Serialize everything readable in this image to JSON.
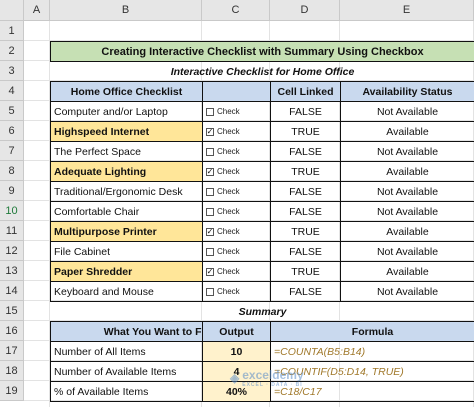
{
  "columns": [
    "A",
    "B",
    "C",
    "D",
    "E"
  ],
  "rows": [
    "1",
    "2",
    "3",
    "4",
    "5",
    "6",
    "7",
    "8",
    "9",
    "10",
    "11",
    "12",
    "13",
    "14",
    "15",
    "16",
    "17",
    "18",
    "19"
  ],
  "title": "Creating Interactive Checklist with Summary Using Checkbox",
  "checklist_caption": "Interactive Checklist for Home Office",
  "checklist_headers": {
    "item": "Home Office Checklist",
    "check": "",
    "linked": "Cell Linked",
    "status": "Availability Status"
  },
  "checkbox_label": "Check",
  "checked_mark": "✓",
  "items": [
    {
      "name": "Computer and/or Laptop",
      "checked": false,
      "linked": "FALSE",
      "status": "Not Available"
    },
    {
      "name": "Highspeed Internet",
      "checked": true,
      "linked": "TRUE",
      "status": "Available"
    },
    {
      "name": "The Perfect Space",
      "checked": false,
      "linked": "FALSE",
      "status": "Not Available"
    },
    {
      "name": "Adequate Lighting",
      "checked": true,
      "linked": "TRUE",
      "status": "Available"
    },
    {
      "name": "Traditional/Ergonomic Desk",
      "checked": false,
      "linked": "FALSE",
      "status": "Not Available"
    },
    {
      "name": "Comfortable Chair",
      "checked": false,
      "linked": "FALSE",
      "status": "Not Available"
    },
    {
      "name": "Multipurpose Printer",
      "checked": true,
      "linked": "TRUE",
      "status": "Available"
    },
    {
      "name": "File Cabinet",
      "checked": false,
      "linked": "FALSE",
      "status": "Not Available"
    },
    {
      "name": "Paper Shredder",
      "checked": true,
      "linked": "TRUE",
      "status": "Available"
    },
    {
      "name": "Keyboard and Mouse",
      "checked": false,
      "linked": "FALSE",
      "status": "Not Available"
    }
  ],
  "summary_caption": "Summary",
  "summary_headers": {
    "find": "What You Want to Find",
    "output": "Output",
    "formula": "Formula"
  },
  "summary": [
    {
      "find": "Number of All Items",
      "output": "10",
      "formula": "=COUNTA(B5:B14)"
    },
    {
      "find": "Number of Available Items",
      "output": "4",
      "formula": "=COUNTIF(D5:D14, TRUE)"
    },
    {
      "find": "% of Available Items",
      "output": "40%",
      "formula": "=C18/C17"
    }
  ],
  "watermark": {
    "name": "exceldemy",
    "tagline": "EXCEL · DATA · BI"
  },
  "colors": {
    "title_bg": "#c6e0b4",
    "header_bg": "#c9d9ee",
    "highlight_bg": "#ffe699",
    "output_bg": "#fff2cc",
    "formula_text": "#a0782a"
  }
}
